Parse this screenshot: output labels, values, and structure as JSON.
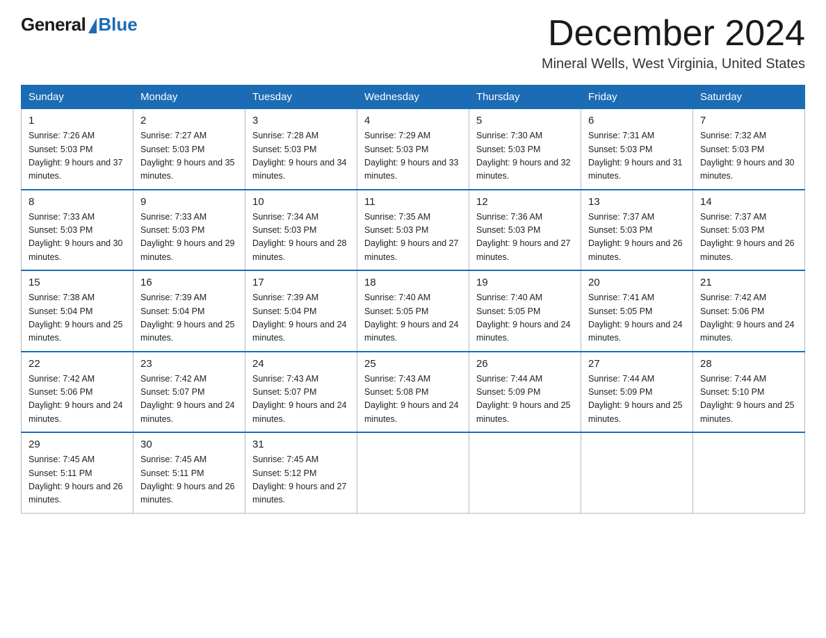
{
  "logo": {
    "general": "General",
    "blue": "Blue"
  },
  "header": {
    "month": "December 2024",
    "location": "Mineral Wells, West Virginia, United States"
  },
  "weekdays": [
    "Sunday",
    "Monday",
    "Tuesday",
    "Wednesday",
    "Thursday",
    "Friday",
    "Saturday"
  ],
  "weeks": [
    [
      {
        "day": "1",
        "sunrise": "7:26 AM",
        "sunset": "5:03 PM",
        "daylight": "9 hours and 37 minutes."
      },
      {
        "day": "2",
        "sunrise": "7:27 AM",
        "sunset": "5:03 PM",
        "daylight": "9 hours and 35 minutes."
      },
      {
        "day": "3",
        "sunrise": "7:28 AM",
        "sunset": "5:03 PM",
        "daylight": "9 hours and 34 minutes."
      },
      {
        "day": "4",
        "sunrise": "7:29 AM",
        "sunset": "5:03 PM",
        "daylight": "9 hours and 33 minutes."
      },
      {
        "day": "5",
        "sunrise": "7:30 AM",
        "sunset": "5:03 PM",
        "daylight": "9 hours and 32 minutes."
      },
      {
        "day": "6",
        "sunrise": "7:31 AM",
        "sunset": "5:03 PM",
        "daylight": "9 hours and 31 minutes."
      },
      {
        "day": "7",
        "sunrise": "7:32 AM",
        "sunset": "5:03 PM",
        "daylight": "9 hours and 30 minutes."
      }
    ],
    [
      {
        "day": "8",
        "sunrise": "7:33 AM",
        "sunset": "5:03 PM",
        "daylight": "9 hours and 30 minutes."
      },
      {
        "day": "9",
        "sunrise": "7:33 AM",
        "sunset": "5:03 PM",
        "daylight": "9 hours and 29 minutes."
      },
      {
        "day": "10",
        "sunrise": "7:34 AM",
        "sunset": "5:03 PM",
        "daylight": "9 hours and 28 minutes."
      },
      {
        "day": "11",
        "sunrise": "7:35 AM",
        "sunset": "5:03 PM",
        "daylight": "9 hours and 27 minutes."
      },
      {
        "day": "12",
        "sunrise": "7:36 AM",
        "sunset": "5:03 PM",
        "daylight": "9 hours and 27 minutes."
      },
      {
        "day": "13",
        "sunrise": "7:37 AM",
        "sunset": "5:03 PM",
        "daylight": "9 hours and 26 minutes."
      },
      {
        "day": "14",
        "sunrise": "7:37 AM",
        "sunset": "5:03 PM",
        "daylight": "9 hours and 26 minutes."
      }
    ],
    [
      {
        "day": "15",
        "sunrise": "7:38 AM",
        "sunset": "5:04 PM",
        "daylight": "9 hours and 25 minutes."
      },
      {
        "day": "16",
        "sunrise": "7:39 AM",
        "sunset": "5:04 PM",
        "daylight": "9 hours and 25 minutes."
      },
      {
        "day": "17",
        "sunrise": "7:39 AM",
        "sunset": "5:04 PM",
        "daylight": "9 hours and 24 minutes."
      },
      {
        "day": "18",
        "sunrise": "7:40 AM",
        "sunset": "5:05 PM",
        "daylight": "9 hours and 24 minutes."
      },
      {
        "day": "19",
        "sunrise": "7:40 AM",
        "sunset": "5:05 PM",
        "daylight": "9 hours and 24 minutes."
      },
      {
        "day": "20",
        "sunrise": "7:41 AM",
        "sunset": "5:05 PM",
        "daylight": "9 hours and 24 minutes."
      },
      {
        "day": "21",
        "sunrise": "7:42 AM",
        "sunset": "5:06 PM",
        "daylight": "9 hours and 24 minutes."
      }
    ],
    [
      {
        "day": "22",
        "sunrise": "7:42 AM",
        "sunset": "5:06 PM",
        "daylight": "9 hours and 24 minutes."
      },
      {
        "day": "23",
        "sunrise": "7:42 AM",
        "sunset": "5:07 PM",
        "daylight": "9 hours and 24 minutes."
      },
      {
        "day": "24",
        "sunrise": "7:43 AM",
        "sunset": "5:07 PM",
        "daylight": "9 hours and 24 minutes."
      },
      {
        "day": "25",
        "sunrise": "7:43 AM",
        "sunset": "5:08 PM",
        "daylight": "9 hours and 24 minutes."
      },
      {
        "day": "26",
        "sunrise": "7:44 AM",
        "sunset": "5:09 PM",
        "daylight": "9 hours and 25 minutes."
      },
      {
        "day": "27",
        "sunrise": "7:44 AM",
        "sunset": "5:09 PM",
        "daylight": "9 hours and 25 minutes."
      },
      {
        "day": "28",
        "sunrise": "7:44 AM",
        "sunset": "5:10 PM",
        "daylight": "9 hours and 25 minutes."
      }
    ],
    [
      {
        "day": "29",
        "sunrise": "7:45 AM",
        "sunset": "5:11 PM",
        "daylight": "9 hours and 26 minutes."
      },
      {
        "day": "30",
        "sunrise": "7:45 AM",
        "sunset": "5:11 PM",
        "daylight": "9 hours and 26 minutes."
      },
      {
        "day": "31",
        "sunrise": "7:45 AM",
        "sunset": "5:12 PM",
        "daylight": "9 hours and 27 minutes."
      },
      null,
      null,
      null,
      null
    ]
  ]
}
